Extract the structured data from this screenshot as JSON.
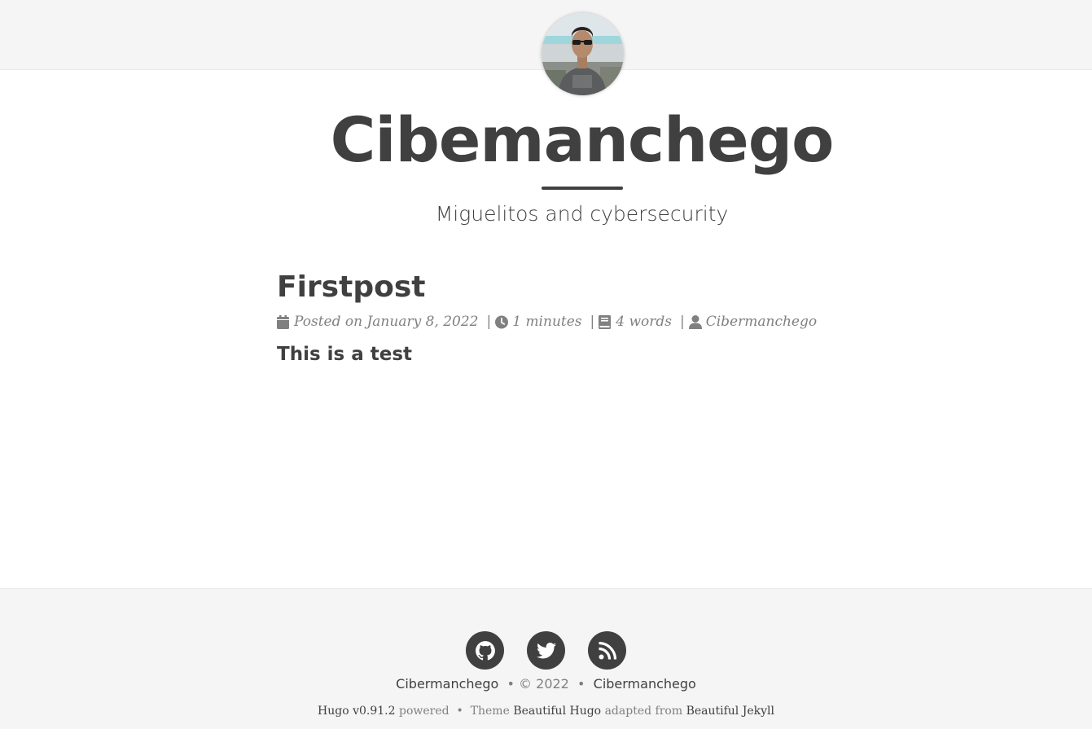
{
  "site": {
    "title": "Cibemanchego",
    "subtitle": "Miguelitos and cybersecurity",
    "avatar_icon": "avatar-photo"
  },
  "post": {
    "title": "Firstpost",
    "meta": {
      "date_text": "Posted on January 8, 2022",
      "reading_time": "1 minutes",
      "word_count": "4 words",
      "author": "Cibermanchego",
      "separator": "|"
    },
    "body": "This is a test"
  },
  "footer": {
    "social_icons": [
      "github-icon",
      "twitter-icon",
      "rss-icon"
    ],
    "copyright_author": "Cibermanchego",
    "copyright_dot": "•",
    "copyright_year": "© 2022",
    "copyright_site": "Cibermanchego",
    "hugo_version": "Hugo v0.91.2",
    "powered_text": "powered",
    "theme_label": "Theme",
    "theme_name": "Beautiful Hugo",
    "adapted_text": "adapted from",
    "adapted_name": "Beautiful Jekyll"
  },
  "colors": {
    "text": "#404040",
    "muted": "#808080",
    "band": "#f5f5f5"
  }
}
